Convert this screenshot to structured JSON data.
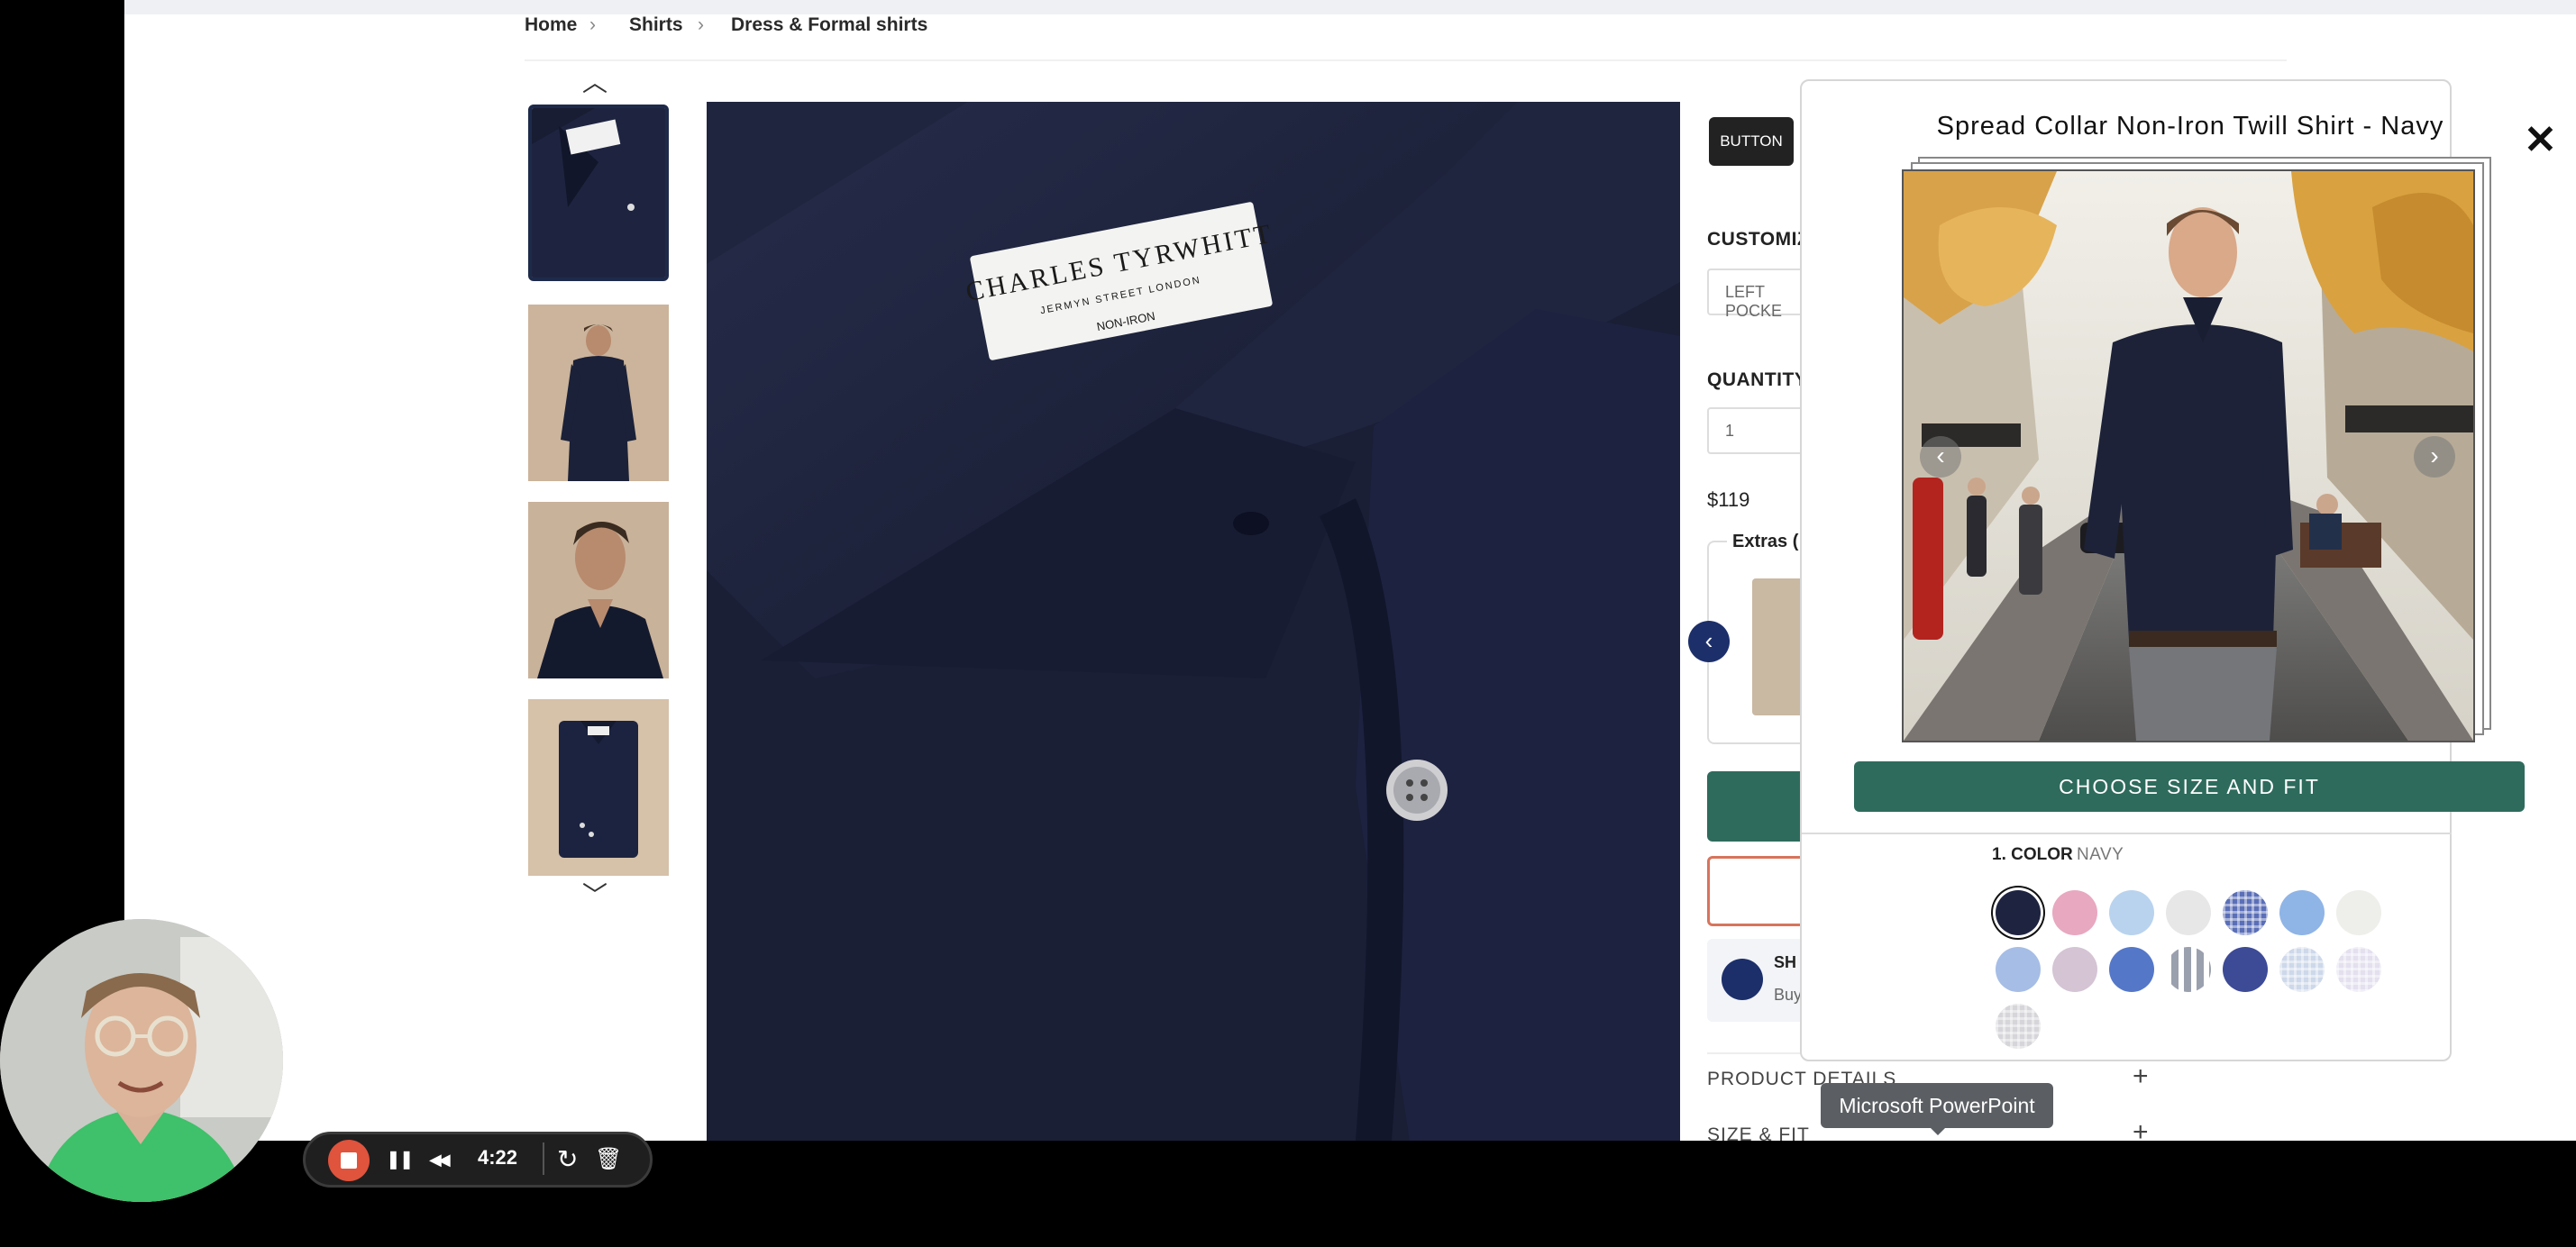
{
  "breadcrumb": {
    "items": [
      "Home",
      "Shirts",
      "Dress & Formal shirts"
    ],
    "separator": "›"
  },
  "gallery": {
    "up_arrow": "︿",
    "down_arrow": "﹀",
    "thumbnails": [
      "collar-closeup",
      "model-full-body",
      "model-portrait",
      "shirt-folded"
    ],
    "label_text": [
      "CHARLES TYRWHITT",
      "JERMYN STREET LONDON",
      "NON-IRON"
    ]
  },
  "product_panel": {
    "button_tag": "BUTTON",
    "customize_label": "CUSTOMIZ",
    "customize_value": "LEFT POCKE",
    "quantity_label": "QUANTITY",
    "quantity_value": "1",
    "price": "$119",
    "extras_label": "Extras (",
    "prev_icon": "‹",
    "shipping_title": "SH",
    "shipping_sub": "Buy",
    "accordion": [
      {
        "label": "PRODUCT DETAILS",
        "icon": "+"
      },
      {
        "label": "SIZE & FIT",
        "icon": "+"
      }
    ]
  },
  "modal": {
    "title": "Spread Collar Non-Iron Twill Shirt - Navy",
    "close_icon": "✕",
    "prev_icon": "‹",
    "next_icon": "›",
    "cta": "CHOOSE SIZE AND FIT",
    "color_label": "1. COLOR",
    "color_value": "NAVY",
    "swatches": [
      {
        "name": "navy",
        "color": "#1e2340",
        "selected": true
      },
      {
        "name": "pink",
        "color": "#e8a8c0"
      },
      {
        "name": "light-blue",
        "color": "#b9d3ee"
      },
      {
        "name": "white",
        "color": "#e7e7e7"
      },
      {
        "name": "blue-check",
        "color": "#5b6fb8",
        "pattern": "check"
      },
      {
        "name": "sky-blue",
        "color": "#8fb4e6"
      },
      {
        "name": "off-white",
        "color": "#eeeeea"
      },
      {
        "name": "cornflower",
        "color": "#a6bde6"
      },
      {
        "name": "lilac",
        "color": "#d4c4d4"
      },
      {
        "name": "mid-blue",
        "color": "#5477c8"
      },
      {
        "name": "grey-stripe",
        "color": "#9aa0ad",
        "pattern": "stripe"
      },
      {
        "name": "royal-navy",
        "color": "#3d4a96"
      },
      {
        "name": "light-blue-check",
        "color": "#cdd8ea",
        "pattern": "check"
      },
      {
        "name": "lavender-check",
        "color": "#e4e0ee",
        "pattern": "check"
      },
      {
        "name": "grey-check",
        "color": "#d6d6da",
        "pattern": "check"
      }
    ]
  },
  "tooltip": {
    "text": "Microsoft PowerPoint"
  },
  "recorder": {
    "time": "4:22",
    "pause_icon": "❚❚",
    "rewind_icon": "◀◀",
    "restart_icon": "↻",
    "delete_icon": "🗑"
  },
  "colors": {
    "brand_green": "#2e6b5c",
    "brand_navy": "#1c2f6b",
    "recorder_red": "#e0533c"
  }
}
